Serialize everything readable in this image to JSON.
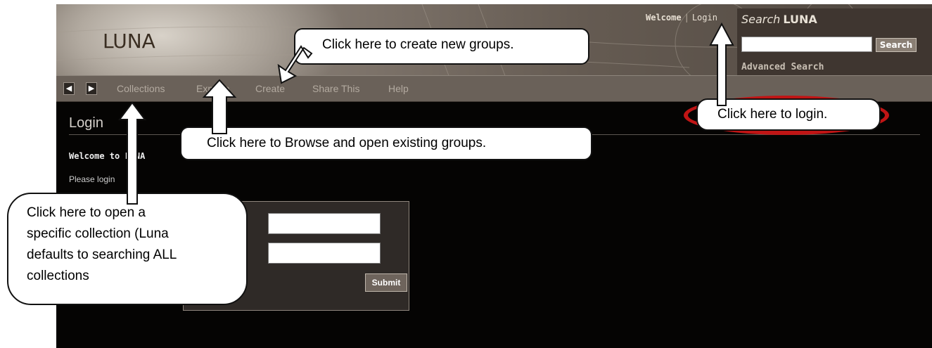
{
  "header": {
    "logo": "LUNA",
    "welcome": "Welcome",
    "separator": "|",
    "login": "Login"
  },
  "search": {
    "title_prefix": "Search",
    "title_brand": "LUNA",
    "input_value": "",
    "button": "Search",
    "advanced": "Advanced Search"
  },
  "nav": {
    "back_icon": "left-arrow-icon",
    "forward_icon": "right-arrow-icon",
    "items": [
      "Collections",
      "Explore",
      "Create",
      "Share This",
      "Help"
    ]
  },
  "page": {
    "title": "Login",
    "welcome": "Welcome to LUNA",
    "instruction": "Please login"
  },
  "form": {
    "username_value": "",
    "password_value": "",
    "submit": "Submit"
  },
  "callouts": {
    "create": "Click here to create new groups.",
    "browse": "Click here to Browse and open existing groups.",
    "collection_lines": [
      "Click here to open a",
      "specific collection (Luna",
      "defaults to searching ALL",
      "collections"
    ],
    "login": "Click here to login."
  },
  "colors": {
    "ring": "#c01515",
    "background": "#050403",
    "nav": "#6a6159"
  }
}
